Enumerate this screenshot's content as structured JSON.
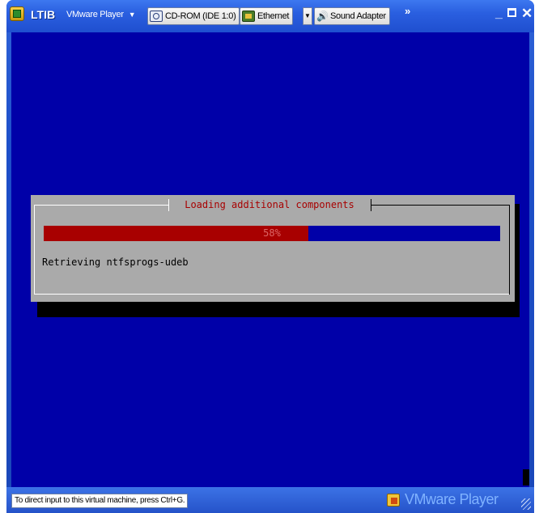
{
  "window": {
    "title": "LTIB",
    "menu_label": "VMware Player",
    "devices": [
      {
        "label": "CD-ROM (IDE 1:0)",
        "icon": "cd-rom-icon"
      },
      {
        "label": "Ethernet",
        "icon": "network-card-icon"
      },
      {
        "label": "Sound Adapter",
        "icon": "speaker-icon"
      }
    ],
    "overflow_glyph": "»",
    "minimize_glyph": "_",
    "close_glyph": "✕"
  },
  "guest": {
    "background_color": "#0000a8",
    "dialog": {
      "title": "Loading additional components",
      "progress_percent": 58,
      "progress_label": "58%",
      "status": "Retrieving ntfsprogs-udeb"
    }
  },
  "statusbar": {
    "message": "To direct input to this virtual machine, press Ctrl+G.",
    "brand": "VMware Player"
  }
}
